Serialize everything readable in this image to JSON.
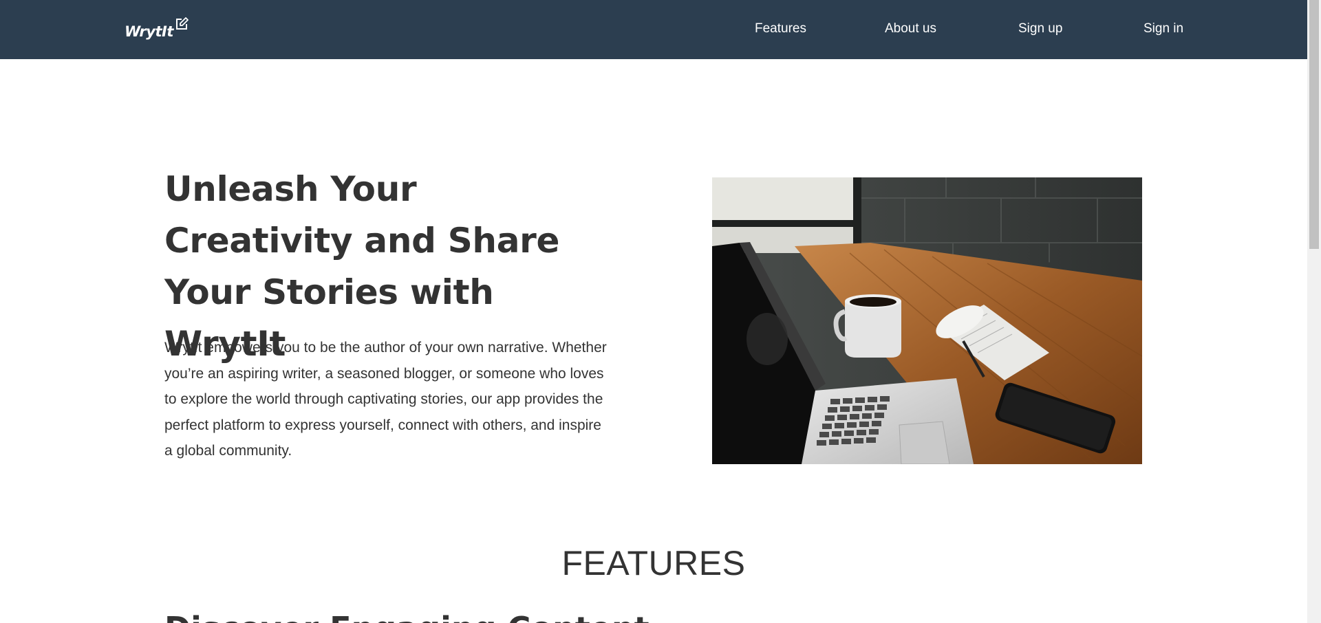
{
  "navbar": {
    "logo_text": "WrytIt",
    "logo_icon": "edit-icon",
    "links": [
      "Features",
      "About us",
      "Sign up",
      "Sign in"
    ]
  },
  "hero": {
    "title": "Unleash Your Creativity and Share Your Stories with WrytIt",
    "description": "WrytIt empowers you to be the author of your own narrative. Whether you’re an aspiring writer, a seasoned blogger, or someone who loves to explore the world through captivating stories, our app provides the perfect platform to express yourself, connect with others, and inspire a global community.",
    "image": "laptop-coffee-desk-photo"
  },
  "features": {
    "heading": "FEATURES",
    "first_title": "Discover Engaging Content"
  },
  "colors": {
    "navbar_bg": "#2c3e50",
    "text": "#333333",
    "background": "#ffffff"
  }
}
